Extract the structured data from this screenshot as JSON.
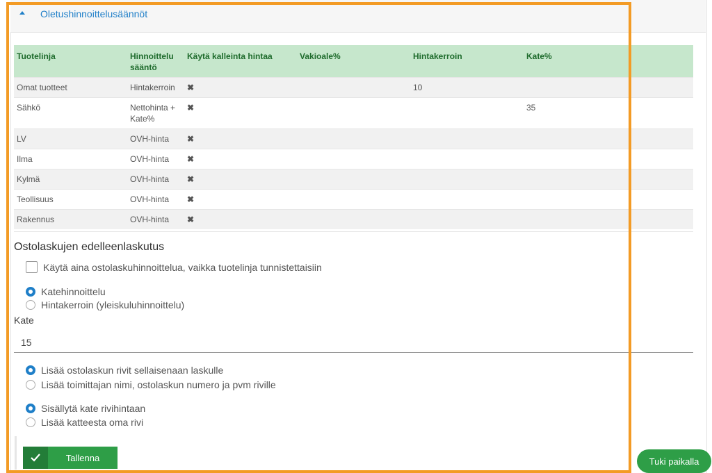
{
  "section": {
    "title": "Oletushinnoittelusäännöt"
  },
  "table": {
    "headers": [
      "Tuotelinja",
      "Hinnoittelu sääntö",
      "Käytä kalleinta hintaa",
      "Vakioale%",
      "Hintakerroin",
      "Kate%"
    ],
    "rows": [
      {
        "line": "Omat tuotteet",
        "rule": "Hintakerroin",
        "mark": "✖",
        "discount": "",
        "factor": "10",
        "margin": ""
      },
      {
        "line": "Sähkö",
        "rule": "Nettohinta + Kate%",
        "mark": "✖",
        "discount": "",
        "factor": "",
        "margin": "35"
      },
      {
        "line": "LV",
        "rule": "OVH-hinta",
        "mark": "✖",
        "discount": "",
        "factor": "",
        "margin": ""
      },
      {
        "line": "Ilma",
        "rule": "OVH-hinta",
        "mark": "✖",
        "discount": "",
        "factor": "",
        "margin": ""
      },
      {
        "line": "Kylmä",
        "rule": "OVH-hinta",
        "mark": "✖",
        "discount": "",
        "factor": "",
        "margin": ""
      },
      {
        "line": "Teollisuus",
        "rule": "OVH-hinta",
        "mark": "✖",
        "discount": "",
        "factor": "",
        "margin": ""
      },
      {
        "line": "Rakennus",
        "rule": "OVH-hinta",
        "mark": "✖",
        "discount": "",
        "factor": "",
        "margin": ""
      }
    ]
  },
  "invoicing": {
    "heading": "Ostolaskujen edelleenlaskutus",
    "always_checkbox": {
      "label": "Käytä aina ostolaskuhinnoittelua, vaikka tuotelinja tunnistettaisiin",
      "checked": false
    },
    "pricing_options": [
      {
        "label": "Katehinnoittelu",
        "selected": true
      },
      {
        "label": "Hintakerroin (yleiskuluhinnoittelu)",
        "selected": false
      }
    ],
    "kate_label": "Kate",
    "kate_value": "15",
    "row_options": [
      {
        "label": "Lisää ostolaskun rivit sellaisenaan laskulle",
        "selected": true
      },
      {
        "label": "Lisää toimittajan nimi, ostolaskun numero ja pvm riville",
        "selected": false
      }
    ],
    "margin_options": [
      {
        "label": "Sisällytä kate rivihintaan",
        "selected": true
      },
      {
        "label": "Lisää katteesta oma rivi",
        "selected": false
      }
    ]
  },
  "buttons": {
    "save": "Tallenna",
    "support": "Tuki paikalla"
  },
  "colors": {
    "accent": "#1f7fc8",
    "header_bg": "#c6e7cc",
    "header_text": "#1e6b2c",
    "save_green": "#2e9e47",
    "highlight_frame": "#f39b25",
    "x_red": "#d9463e"
  },
  "icons": {
    "collapse": "caret-up-icon",
    "not_used": "x-mark-icon",
    "save": "check-icon"
  }
}
